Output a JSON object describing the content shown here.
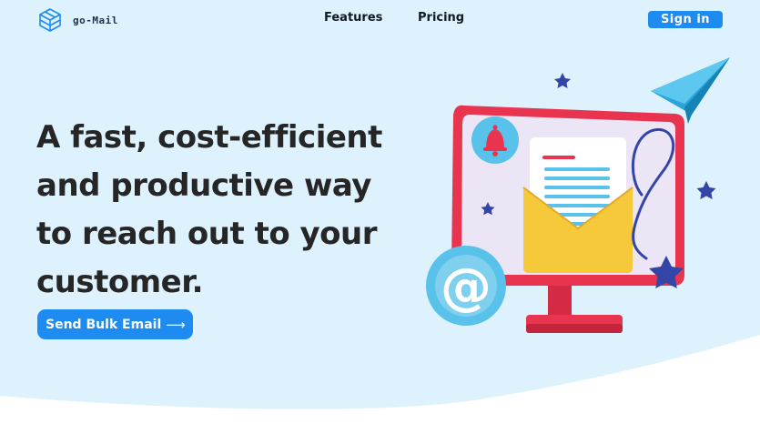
{
  "brand": {
    "name": "go-Mail",
    "logo_icon": "cube-logo-icon"
  },
  "nav": {
    "links": [
      "Features",
      "Pricing"
    ],
    "sign_in_label": "Sign in"
  },
  "hero": {
    "headline_lines": [
      "A fast, cost-efficient",
      "and productive way",
      "to reach out to your",
      "customer."
    ],
    "cta_label": "Send Bulk Email",
    "cta_arrow": "⟶",
    "illustration": {
      "icons": [
        "computer-monitor-icon",
        "envelope-icon",
        "bell-icon",
        "at-sign-icon",
        "paper-plane-icon",
        "star-icon"
      ],
      "at_symbol": "@"
    }
  },
  "colors": {
    "background": "#ddf2fd",
    "accent": "#1e8bf0",
    "headline": "#262626",
    "monitor_frame": "#e8344f",
    "envelope": "#f5c93a",
    "star": "#3346a8"
  }
}
